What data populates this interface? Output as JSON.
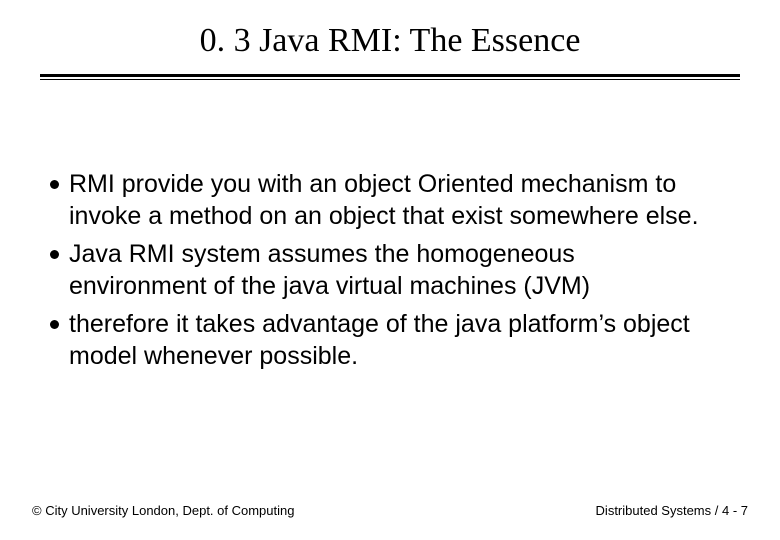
{
  "title": "0. 3 Java RMI: The Essence",
  "bullets": [
    "RMI provide you with an object Oriented mechanism to invoke a method on an object that exist somewhere else.",
    "Java RMI system assumes the homogeneous environment of the java virtual machines (JVM)",
    "therefore it takes advantage of the java platform’s object model whenever possible."
  ],
  "footer": {
    "left": "© City University London, Dept. of Computing",
    "right": "Distributed Systems / 4 - 7"
  }
}
